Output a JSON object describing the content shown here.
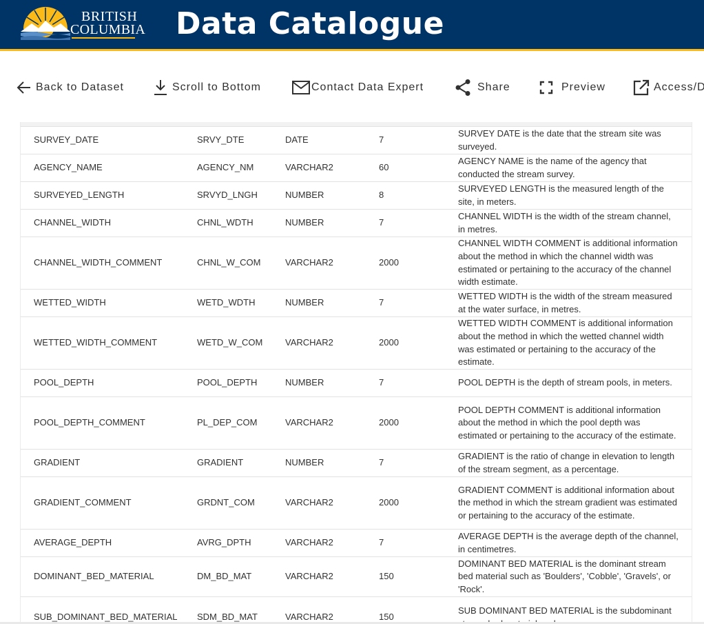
{
  "header": {
    "logo_line1": "BRITISH",
    "logo_line2": "COLUMBIA",
    "title": "Data Catalogue"
  },
  "toolbar": {
    "back": "Back to Dataset",
    "scroll": "Scroll to Bottom",
    "contact": "Contact Data Expert",
    "share": "Share",
    "preview": "Preview",
    "access": "Access/Download"
  },
  "rows": [
    {
      "name": "SURVEY_DATE",
      "short": "SRVY_DTE",
      "type": "DATE",
      "length": "7",
      "description": "SURVEY DATE is the date that the stream site was surveyed."
    },
    {
      "name": "AGENCY_NAME",
      "short": "AGENCY_NM",
      "type": "VARCHAR2",
      "length": "60",
      "description": "AGENCY NAME is the name of the agency that conducted the stream survey."
    },
    {
      "name": "SURVEYED_LENGTH",
      "short": "SRVYD_LNGH",
      "type": "NUMBER",
      "length": "8",
      "description": "SURVEYED LENGTH is the measured length of the site, in meters."
    },
    {
      "name": "CHANNEL_WIDTH",
      "short": "CHNL_WDTH",
      "type": "NUMBER",
      "length": "7",
      "description": "CHANNEL WIDTH is the width of the stream channel, in metres."
    },
    {
      "name": "CHANNEL_WIDTH_COMMENT",
      "short": "CHNL_W_COM",
      "type": "VARCHAR2",
      "length": "2000",
      "description": "CHANNEL WIDTH COMMENT is additional information about the method in which the channel width was estimated or pertaining to the accuracy of the channel width estimate."
    },
    {
      "name": "WETTED_WIDTH",
      "short": "WETD_WDTH",
      "type": "NUMBER",
      "length": "7",
      "description": "WETTED WIDTH is the width of the stream measured at the water surface, in metres."
    },
    {
      "name": "WETTED_WIDTH_COMMENT",
      "short": "WETD_W_COM",
      "type": "VARCHAR2",
      "length": "2000",
      "description": "WETTED WIDTH COMMENT is additional information about the method in which the wetted channel width was estimated or pertaining to the accuracy of the estimate."
    },
    {
      "name": "POOL_DEPTH",
      "short": "POOL_DEPTH",
      "type": "NUMBER",
      "length": "7",
      "description": "POOL DEPTH is the depth of stream pools, in meters."
    },
    {
      "name": "POOL_DEPTH_COMMENT",
      "short": "PL_DEP_COM",
      "type": "VARCHAR2",
      "length": "2000",
      "description": "POOL DEPTH COMMENT is additional information about the method in which the pool depth was estimated or pertaining to the accuracy of the estimate."
    },
    {
      "name": "GRADIENT",
      "short": "GRADIENT",
      "type": "NUMBER",
      "length": "7",
      "description": "GRADIENT is the ratio of change in elevation to length of the stream segment, as a percentage."
    },
    {
      "name": "GRADIENT_COMMENT",
      "short": "GRDNT_COM",
      "type": "VARCHAR2",
      "length": "2000",
      "description": "GRADIENT COMMENT is additional information about the method in which the stream gradient was estimated or pertaining to the accuracy of the estimate."
    },
    {
      "name": "AVERAGE_DEPTH",
      "short": "AVRG_DPTH",
      "type": "VARCHAR2",
      "length": "7",
      "description": "AVERAGE DEPTH is the average depth of the channel, in centimetres."
    },
    {
      "name": "DOMINANT_BED_MATERIAL",
      "short": "DM_BD_MAT",
      "type": "VARCHAR2",
      "length": "150",
      "description": "DOMINANT BED MATERIAL is the dominant stream bed material such as 'Boulders', 'Cobble', 'Gravels', or 'Rock'."
    },
    {
      "name": "SUB_DOMINANT_BED_MATERIAL",
      "short": "SDM_BD_MAT",
      "type": "VARCHAR2",
      "length": "150",
      "description": "SUB DOMINANT BED MATERIAL is the subdominant stream bed material such as"
    }
  ]
}
